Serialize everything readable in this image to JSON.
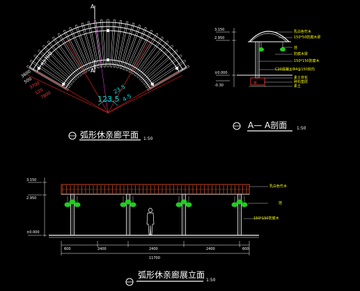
{
  "plan": {
    "title": "弧形休亲廊平面",
    "scale": "1:50",
    "section_mark": "A",
    "dims": [
      "R3700",
      "3600",
      "500",
      "3700",
      "120",
      "7800",
      "123.5",
      "23.5",
      "100",
      "4-5",
      "47"
    ]
  },
  "section": {
    "title": "A— A剖面",
    "scale": "1:50",
    "levels": [
      "3.150",
      "2.950",
      "±0.000",
      "-0.30"
    ],
    "labels": [
      "乳白色竹木",
      "150*50防腐木梁",
      "挂",
      "防腐木梁",
      "150*150防腐木",
      "C20混凝土Ф4@150双向",
      "素土夯实",
      "碎石垫层",
      "素土"
    ]
  },
  "elevation": {
    "title": "弧形休亲廊展立面",
    "scale": "1:50",
    "levels": [
      "3.150",
      "2.950",
      "±0.000"
    ],
    "labels": [
      "乳白色竹木",
      "挂",
      "150*150防腐木"
    ],
    "dims": [
      "600",
      "2400",
      "2400",
      "2400",
      "600"
    ],
    "total": "11700"
  },
  "colors": {
    "background": "#000000",
    "line": "#ffffff",
    "dimension": "#ff2020",
    "text": "#ffff00",
    "plant": "#22cc22",
    "beam": "#cc4422",
    "cyan": "#00dddd",
    "magenta": "#ff44ff"
  }
}
